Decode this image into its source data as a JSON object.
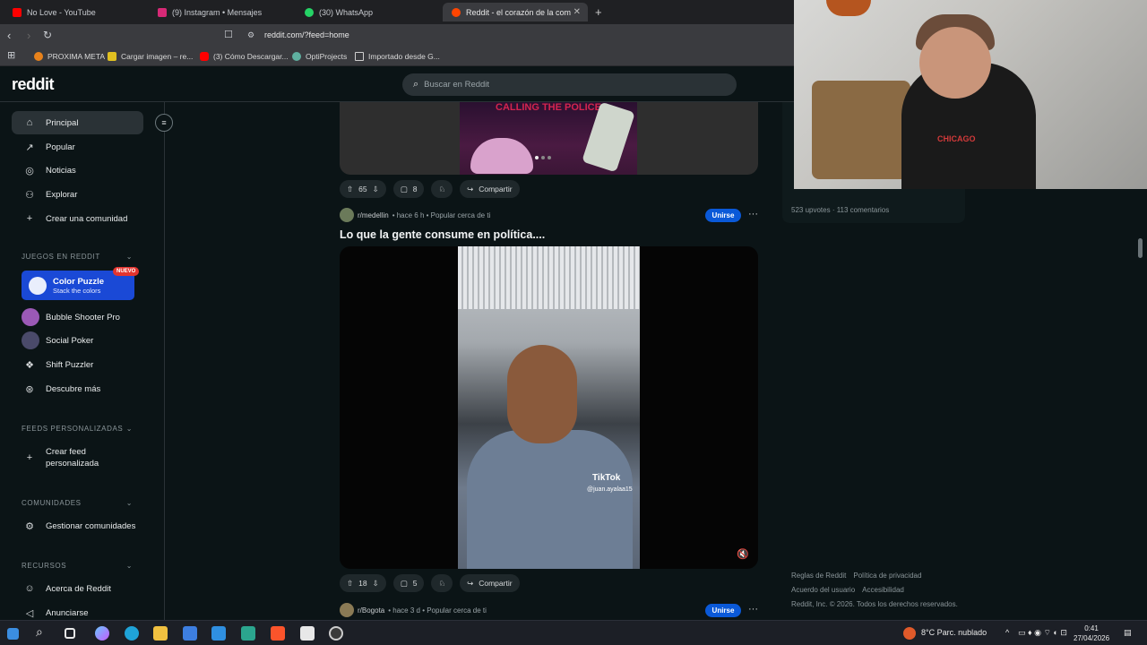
{
  "browser": {
    "tabs": [
      {
        "label": "No Love - YouTube",
        "icon": "youtube-icon",
        "color": "#ff0000"
      },
      {
        "label": "(9) Instagram • Mensajes",
        "icon": "instagram-icon",
        "color": "#d62976"
      },
      {
        "label": "(30) WhatsApp",
        "icon": "whatsapp-icon",
        "color": "#25d366"
      },
      {
        "label": "Reddit - el corazón de la com",
        "icon": "reddit-icon",
        "color": "#ff4500"
      }
    ],
    "new_tab": "+",
    "url": "reddit.com/?feed=home",
    "bookmarks": [
      {
        "label": "PROXIMA META",
        "color": "#e8821b"
      },
      {
        "label": "Cargar imagen – re...",
        "color": "#e0c020"
      },
      {
        "label": "(3) Cómo Descargar...",
        "color": "#ff0000"
      },
      {
        "label": "OptiProjects",
        "color": "#5fb0a0"
      },
      {
        "label": "Importado desde G...",
        "color": "#cfcfcf"
      }
    ]
  },
  "header": {
    "logo": "reddit",
    "search_placeholder": "Buscar en Reddit"
  },
  "sidebar": {
    "main_items": [
      {
        "label": "Principal",
        "icon": "home-icon",
        "glyph": "⌂",
        "active": true
      },
      {
        "label": "Popular",
        "icon": "popular-icon",
        "glyph": "↗"
      },
      {
        "label": "Noticias",
        "icon": "news-icon",
        "glyph": "◎"
      },
      {
        "label": "Explorar",
        "icon": "explore-icon",
        "glyph": "⚇"
      },
      {
        "label": "Crear una comunidad",
        "icon": "plus-icon",
        "glyph": "+"
      }
    ],
    "games_header": "JUEGOS EN REDDIT",
    "featured_game": {
      "title": "Color Puzzle",
      "subtitle": "Stack the colors",
      "badge": "NUEVO"
    },
    "games": [
      {
        "label": "Bubble Shooter Pro",
        "color": "#9b59b6"
      },
      {
        "label": "Social Poker",
        "color": "#4a4a6a"
      },
      {
        "label": "Shift Puzzler",
        "color": "#2a3236"
      },
      {
        "label": "Descubre más",
        "color": "#2a3236"
      }
    ],
    "feeds_header": "FEEDS PERSONALIZADAS",
    "create_feed_line1": "Crear feed",
    "create_feed_line2": "personalizada",
    "communities_header": "COMUNIDADES",
    "manage_communities": "Gestionar comunidades",
    "resources_header": "RECURSOS",
    "about": "Acerca de Reddit",
    "advertise": "Anunciarse"
  },
  "feed": {
    "post1": {
      "upvotes": "65",
      "comments": "8",
      "share": "Compartir",
      "media_text": "CALLING THE POLICE"
    },
    "post2": {
      "subreddit": "r/medellin",
      "meta": "• hace 6 h • Popular cerca de ti",
      "join": "Unirse",
      "title": "Lo que la gente consume en política....",
      "tiktok_label": "TikTok",
      "tiktok_handle": "@juan.ayalaa15",
      "upvotes": "18",
      "comments": "5",
      "share": "Compartir"
    },
    "post3": {
      "subreddit": "r/Bogota",
      "meta": "• hace 3 d • Popular cerca de ti",
      "join": "Unirse"
    }
  },
  "right_panel": {
    "stats": "523 upvotes · 113 comentarios",
    "footer_links_row1": [
      "Reglas de Reddit",
      "Política de privacidad"
    ],
    "footer_links_row2": [
      "Acuerdo del usuario",
      "Accesibilidad"
    ],
    "copyright": "Reddit, Inc. © 2026. Todos los derechos reservados."
  },
  "webcam": {
    "jersey_text": "CHICAGO"
  },
  "taskbar": {
    "weather": "8°C  Parc. nublado",
    "time": "0:41",
    "date": "27/04/2026",
    "apps": [
      {
        "icon": "windows-icon",
        "color": "#3b8de0"
      },
      {
        "icon": "search-icon",
        "color": "#e8e8e8"
      },
      {
        "icon": "task-view-icon",
        "color": "#e8e8e8"
      },
      {
        "icon": "copilot-icon",
        "color": "#6ac6ff"
      },
      {
        "icon": "edge-icon",
        "color": "#1fa3d8"
      },
      {
        "icon": "file-explorer-icon",
        "color": "#f0c040"
      },
      {
        "icon": "store-icon",
        "color": "#3d7ee0"
      },
      {
        "icon": "mail-icon",
        "color": "#2f8fe0"
      },
      {
        "icon": "app-icon",
        "color": "#2ba58e"
      },
      {
        "icon": "brave-icon",
        "color": "#fb542b"
      },
      {
        "icon": "capcut-icon",
        "color": "#e8e8e8"
      },
      {
        "icon": "obs-icon",
        "color": "#cccccc"
      }
    ]
  }
}
